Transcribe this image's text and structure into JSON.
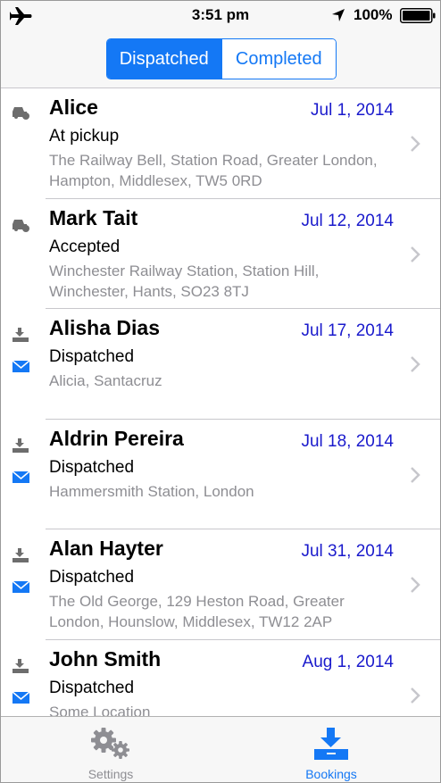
{
  "status_bar": {
    "time": "3:51 pm",
    "battery": "100%",
    "icons": [
      "airplane-icon",
      "location-arrow-icon",
      "battery-icon"
    ]
  },
  "segments": {
    "dispatched": "Dispatched",
    "completed": "Completed",
    "selected": "Dispatched",
    "accent_color": "#1478f5"
  },
  "bookings": [
    {
      "name": "Alice",
      "date": "Jul 1, 2014",
      "status": "At pickup",
      "address": "The Railway Bell, Station Road, Greater London, Hampton, Middlesex, TW5 0RD",
      "icons": [
        "car-icon"
      ]
    },
    {
      "name": "Mark Tait",
      "date": "Jul 12, 2014",
      "status": "Accepted",
      "address": "Winchester Railway Station, Station Hill, Winchester, Hants, SO23 8TJ",
      "icons": [
        "car-icon"
      ]
    },
    {
      "name": "Alisha Dias",
      "date": "Jul 17, 2014",
      "status": "Dispatched",
      "address": "Alicia, Santacruz",
      "icons": [
        "dispatch-icon",
        "mail-icon"
      ]
    },
    {
      "name": "Aldrin Pereira",
      "date": "Jul 18, 2014",
      "status": "Dispatched",
      "address": "Hammersmith Station, London",
      "icons": [
        "dispatch-icon",
        "mail-icon"
      ]
    },
    {
      "name": "Alan Hayter",
      "date": "Jul 31, 2014",
      "status": "Dispatched",
      "address": "The Old George, 129 Heston Road, Greater London, Hounslow, Middlesex, TW12 2AP",
      "icons": [
        "dispatch-icon",
        "mail-icon"
      ]
    },
    {
      "name": "John Smith",
      "date": "Aug 1, 2014",
      "status": "Dispatched",
      "address": "Some Location",
      "icons": [
        "dispatch-icon",
        "mail-icon"
      ]
    }
  ],
  "colors": {
    "date": "#1a1acc",
    "address": "#8e8e93",
    "mail_icon": "#1478f5"
  },
  "tab_bar": {
    "settings": {
      "label": "Settings",
      "icon": "gears-icon"
    },
    "bookings": {
      "label": "Bookings",
      "icon": "bookings-tray-icon"
    },
    "selected": "Bookings"
  }
}
